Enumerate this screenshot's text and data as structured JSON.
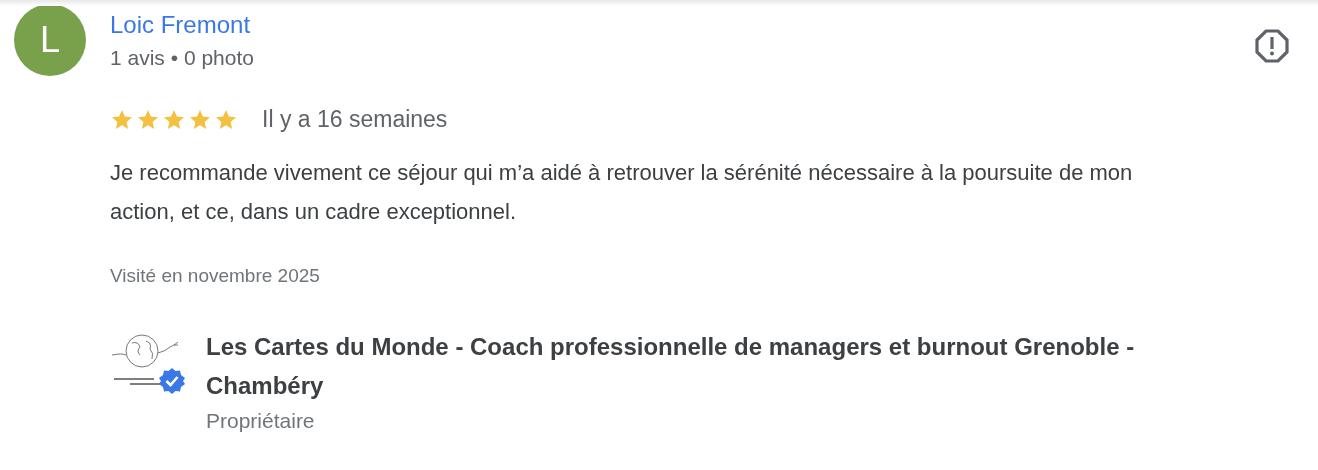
{
  "reviewer": {
    "initial": "L",
    "name": "Loic Fremont",
    "stats": "1 avis • 0 photo"
  },
  "review": {
    "stars": 5,
    "time": "Il y a 16 semaines",
    "text": "Je recommande vivement ce séjour qui m’a aidé à retrouver la sérénité nécessaire à la poursuite de mon action, et ce, dans un cadre exceptionnel.",
    "visit": "Visité en novembre 2025"
  },
  "owner": {
    "name": "Les Cartes du Monde - Coach professionnelle de managers et burnout Grenoble - Chambéry",
    "role": "Propriétaire",
    "verified": true
  }
}
